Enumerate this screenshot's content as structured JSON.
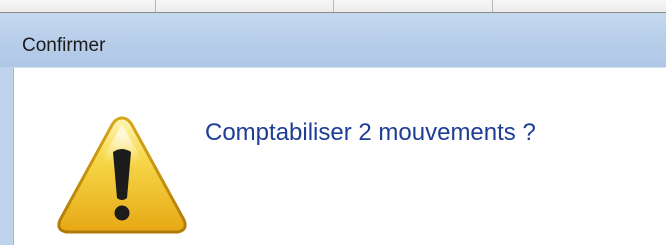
{
  "dialog": {
    "title": "Confirmer",
    "message": "Comptabiliser 2 mouvements ?",
    "icon": "warning-icon"
  },
  "colors": {
    "message_text": "#1e3d96",
    "titlebar": "#b9cfea",
    "warning_yellow": "#f3c71a"
  }
}
